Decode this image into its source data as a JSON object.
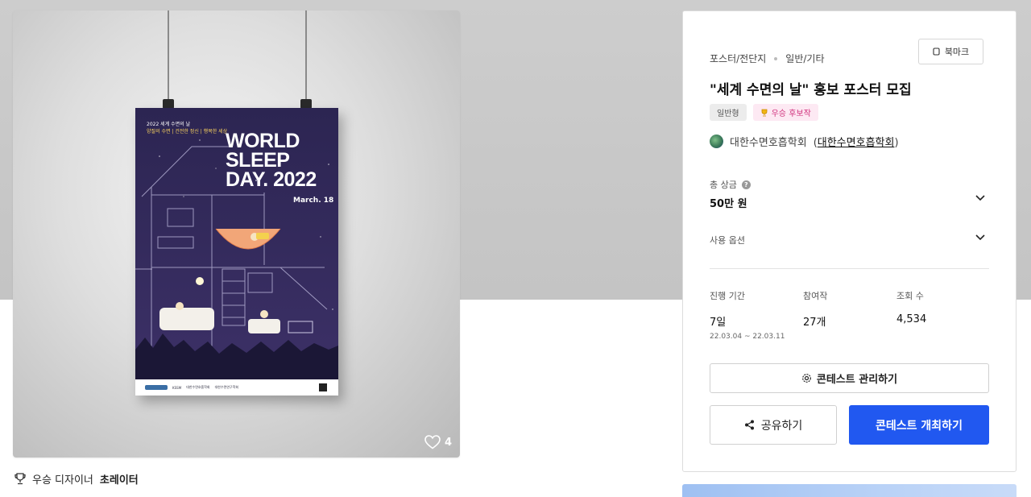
{
  "hero": {
    "poster": {
      "top_line1": "2022 세계 수면의 날",
      "top_line2": "양질의 수면 | 건전한 정신 | 행복한 세상",
      "title_line1": "WORLD",
      "title_line2": "SLEEP",
      "title_line3": "DAY. 2022",
      "date": "March. 18",
      "footer_org1": "KSSM",
      "footer_org2": "대한수면호흡학회",
      "footer_org3": "대한수면연구학회"
    },
    "like_count": "4",
    "like_icon": "heart-outline-icon"
  },
  "designer": {
    "icon": "trophy-icon",
    "prefix": "우승 디자이너",
    "name": "초레이터"
  },
  "card": {
    "category_main": "포스터/전단지",
    "category_sub": "일반/기타",
    "bookmark_label": "북마크",
    "title": "\"세계 수면의 날\" 홍보 포스터 모집",
    "tags": [
      "일반형",
      "우승 후보작"
    ],
    "host_name": "대한수면호흡학회",
    "host_link": "대한수면호흡학회",
    "prize_label": "총 상금",
    "prize_value": "50만 원",
    "usage_label": "사용 옵션",
    "stats": {
      "period_label": "진행 기간",
      "period_value": "7일",
      "period_dates": "22.03.04 ~ 22.03.11",
      "participants_label": "참여작",
      "participants_value": "27개",
      "views_label": "조회 수",
      "views_value": "4,534"
    },
    "manage_button": "콘테스트 관리하기",
    "share_button": "공유하기",
    "host_button": "콘테스트 개최하기"
  },
  "colors": {
    "primary": "#2158f0",
    "poster_bg": "#322a58",
    "tag_pink_text": "#d0307c"
  }
}
